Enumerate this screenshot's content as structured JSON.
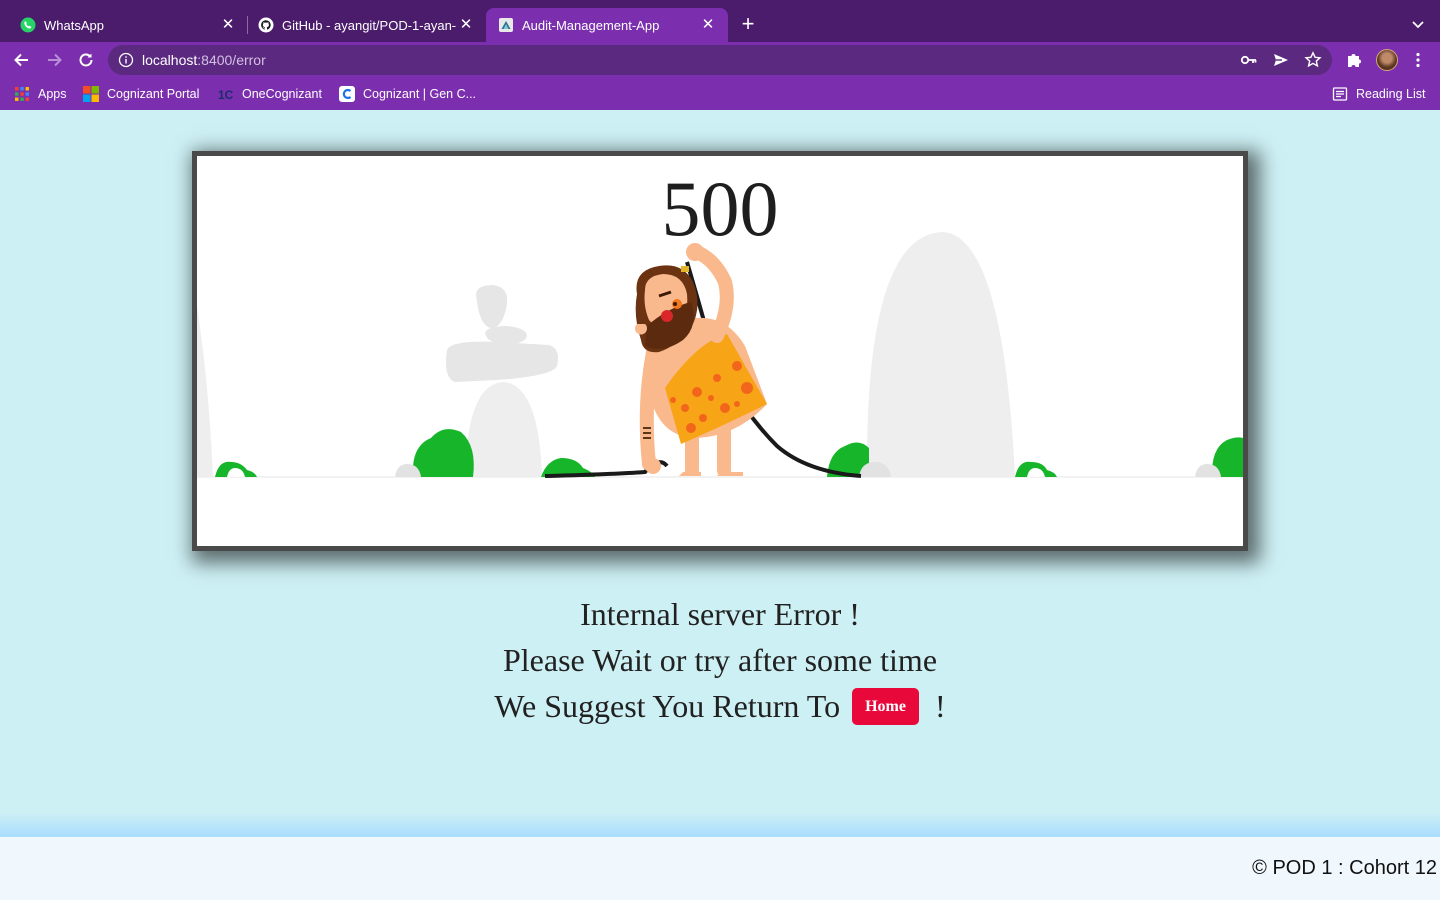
{
  "browser": {
    "tabs": [
      {
        "title": "WhatsApp",
        "icon": "whatsapp-icon",
        "active": false
      },
      {
        "title": "GitHub - ayangit/POD-1-ayan-",
        "icon": "github-icon",
        "active": false
      },
      {
        "title": "Audit-Management-App",
        "icon": "app-icon",
        "active": true
      }
    ],
    "url_host": "localhost",
    "url_rest": ":8400/error",
    "bookmarks": [
      {
        "label": "Apps",
        "icon": "apps-grid-icon"
      },
      {
        "label": "Cognizant Portal",
        "icon": "cognizant-portal-icon"
      },
      {
        "label": "OneCognizant",
        "icon": "onecognizant-icon"
      },
      {
        "label": "Cognizant | Gen C...",
        "icon": "genc-icon"
      }
    ],
    "reading_list": "Reading List"
  },
  "error": {
    "code": "500",
    "line1": "Internal server Error !",
    "line2": "Please Wait or try after some time",
    "line3_prefix": "We Suggest You Return To",
    "home_button": "Home",
    "line3_suffix": "!"
  },
  "footer": {
    "text": "© POD 1 : Cohort 12"
  },
  "colors": {
    "tabstrip": "#4a1c6b",
    "toolbar": "#7b2fae",
    "page_background": "#cdf0f4",
    "home_button": "#e8093a",
    "footer": "#f0f7fd"
  }
}
